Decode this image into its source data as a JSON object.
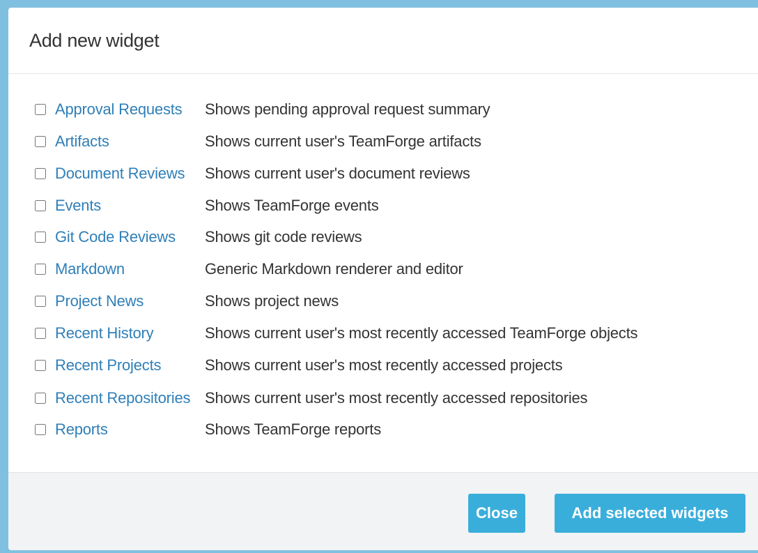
{
  "dialog": {
    "title": "Add new widget"
  },
  "widgets": [
    {
      "name": "Approval Requests",
      "description": "Shows pending approval request summary"
    },
    {
      "name": "Artifacts",
      "description": "Shows current user's TeamForge artifacts"
    },
    {
      "name": "Document Reviews",
      "description": "Shows current user's document reviews"
    },
    {
      "name": "Events",
      "description": "Shows TeamForge events"
    },
    {
      "name": "Git Code Reviews",
      "description": "Shows git code reviews"
    },
    {
      "name": "Markdown",
      "description": "Generic Markdown renderer and editor"
    },
    {
      "name": "Project News",
      "description": "Shows project news"
    },
    {
      "name": "Recent History",
      "description": "Shows current user's most recently accessed TeamForge objects"
    },
    {
      "name": "Recent Projects",
      "description": "Shows current user's most recently accessed projects"
    },
    {
      "name": "Recent Repositories",
      "description": "Shows current user's most recently accessed repositories"
    },
    {
      "name": "Reports",
      "description": "Shows TeamForge reports"
    }
  ],
  "footer": {
    "close_label": "Close",
    "add_label": "Add selected widgets"
  },
  "colors": {
    "link": "#2f7fb8",
    "button": "#3aaedb",
    "backdrop": "#7fc0e0"
  }
}
